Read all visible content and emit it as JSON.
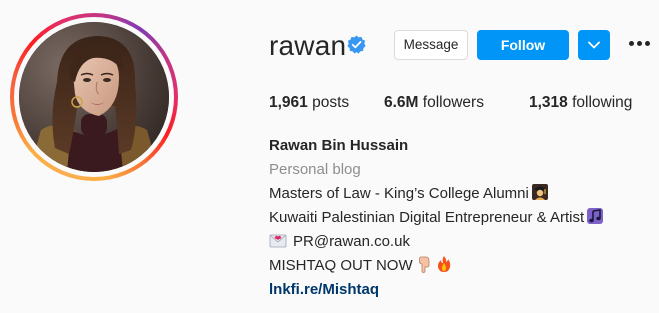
{
  "profile": {
    "username": "rawan",
    "verified": true,
    "avatar": "profile-photo-with-story-ring"
  },
  "actions": {
    "message_label": "Message",
    "follow_label": "Follow",
    "dropdown_icon": "chevron-down-icon",
    "more_icon": "more-horizontal-icon"
  },
  "stats": {
    "posts_count": "1,961",
    "posts_label": "posts",
    "followers_count": "6.6M",
    "followers_label": "followers",
    "following_count": "1,318",
    "following_label": "following"
  },
  "bio": {
    "full_name": "Rawan Bin Hussain",
    "category": "Personal blog",
    "line1": "Masters of Law - King’s College Alumni",
    "line1_emoji": "graduate-emoji",
    "line2": "Kuwaiti Palestinian Digital Entrepreneur & Artist",
    "line2_emoji": "music-notes-emoji",
    "line3": "PR@rawan.co.uk",
    "line3_emoji": "envelope-with-heart-emoji",
    "line4": "MISHTAQ OUT NOW",
    "line4_emojis": [
      "hand-pointing-down-emoji",
      "fire-emoji"
    ],
    "link": "lnkfi.re/Mishtaq"
  },
  "colors": {
    "follow_blue": "#0095f6",
    "link_navy": "#00376b",
    "verified_blue": "#3897f0",
    "muted_gray": "#8e8e8e"
  }
}
